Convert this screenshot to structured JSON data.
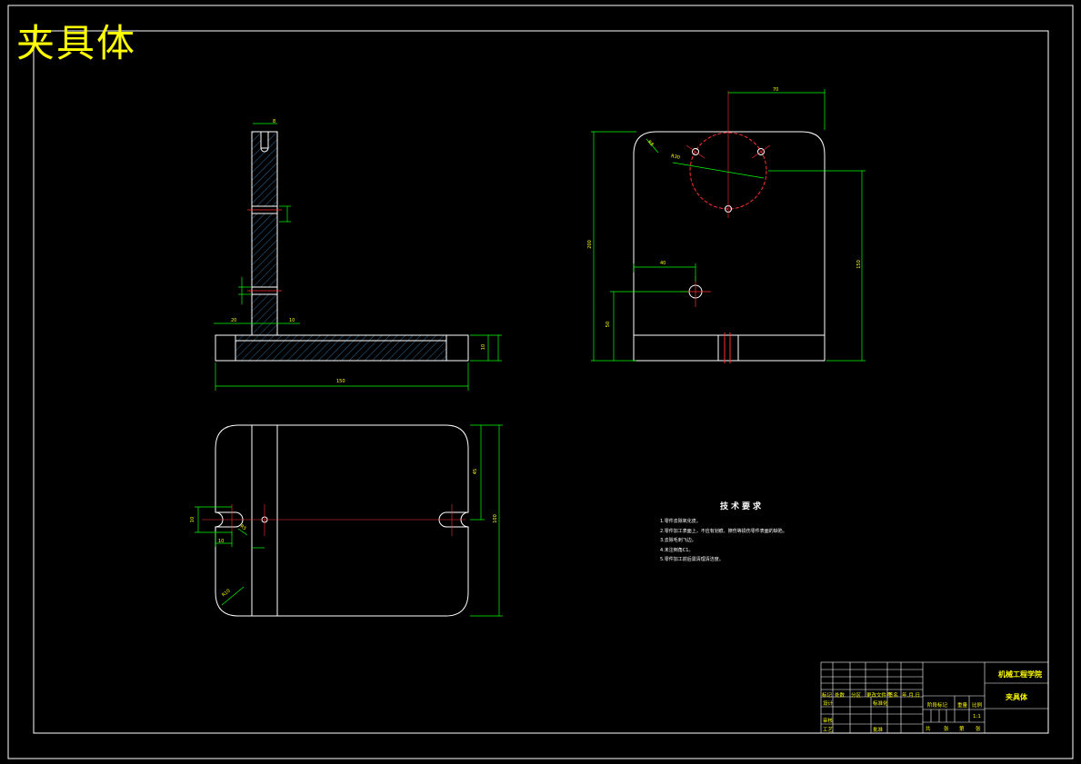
{
  "title": "夹具体",
  "tech_requirements": {
    "heading": "技术要求",
    "items": [
      "1.零件去除氧化皮。",
      "2.零件加工表面上，不应有划痕、擦伤等损伤零件表面的缺陷。",
      "3.去除毛刺飞边。",
      "4.未注倒角C1。",
      "5.零件加工前后需清理清洁度。"
    ]
  },
  "title_block": {
    "school": "机械工程学院",
    "drawing_name": "夹具体",
    "scale": "1:1",
    "row_labels": [
      "标记",
      "处数",
      "分区",
      "更改文件号",
      "签名",
      "年.月.日"
    ],
    "design_label": "设计",
    "std_label": "标准化",
    "review_label": "审核",
    "process_label": "工艺",
    "approve_label": "批准",
    "stage_label": "阶段标记",
    "weight_label": "重量",
    "scale_label": "比例",
    "sheets": [
      "共",
      "张",
      "第",
      "张"
    ]
  },
  "dimensions": {
    "top_width": "70",
    "angle_r": "R8",
    "radius_r": "R30",
    "height_left": "200",
    "height_right": "150",
    "hole_x": "40",
    "hole_y": "50",
    "base_len": "150",
    "base_h": "10",
    "slot_w": "8",
    "thick": "20",
    "gap": "10",
    "plan_h": "100",
    "plan_h2": "45",
    "slot_d": "10",
    "slot_len": "10",
    "r_corner": "R10",
    "r_small": "R5"
  }
}
